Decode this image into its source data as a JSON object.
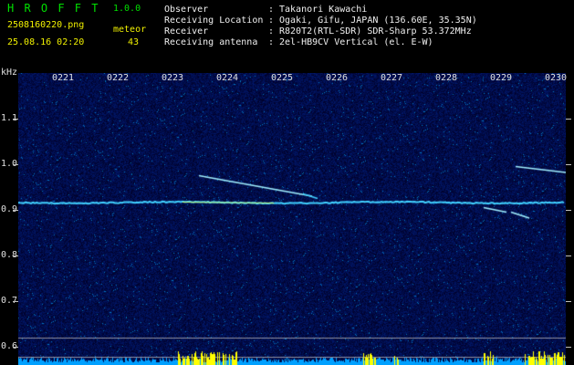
{
  "header": {
    "app_name": "H R O F F T",
    "version": "1.0.0",
    "filename": "2508160220.png",
    "category": "meteor",
    "datetime": "25.08.16 02:20",
    "count": "43",
    "fields": [
      {
        "label": "Observer",
        "sep": ":",
        "value": "Takanori Kawachi"
      },
      {
        "label": "Receiving Location",
        "sep": ":",
        "value": "Ogaki, Gifu, JAPAN (136.60E, 35.35N)"
      },
      {
        "label": "Receiver",
        "sep": ":",
        "value": "R820T2(RTL-SDR) SDR-Sharp 53.372MHz"
      },
      {
        "label": "Receiving antenna",
        "sep": ":",
        "value": "2el-HB9CV Vertical (el. E-W)"
      }
    ]
  },
  "axis": {
    "unit": "kHz",
    "y_ticks": [
      "1.1",
      "1.0",
      "0.9",
      "0.8",
      "0.7",
      "0.6"
    ],
    "x_ticks": [
      "0221",
      "0222",
      "0223",
      "0224",
      "0225",
      "0226",
      "0227",
      "0228",
      "0229",
      "0230"
    ]
  },
  "colors": {
    "background": "#000a3c",
    "carrier": "#40d0ff",
    "echo": "#a0f0ff",
    "noise_bar": "#00a0ff",
    "level_peak": "#ffff00"
  }
}
